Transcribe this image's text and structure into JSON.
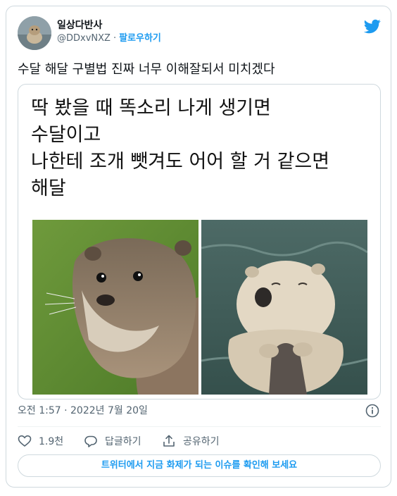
{
  "user": {
    "display_name": "일상다반사",
    "handle": "@DDxvNXZ",
    "separator": "·",
    "follow_label": "팔로우하기"
  },
  "tweet": {
    "text": "수달 해달 구별법 진짜 너무 이해잘되서 미치겠다"
  },
  "media": {
    "lines": [
      "딱 봤을 때 똑소리 나게 생기면",
      "수달이고",
      "나한테 조개 뺏겨도 어어 할 거 같으면",
      "해달"
    ]
  },
  "meta": {
    "timestamp": "오전 1:57 · 2022년 7월 20일"
  },
  "actions": {
    "like_count": "1.9천",
    "reply_label": "답글하기",
    "share_label": "공유하기"
  },
  "cta": {
    "label": "트위터에서 지금 화제가 되는 이슈를 확인해 보세요"
  },
  "colors": {
    "accent": "#1d9bf0",
    "secondary_text": "#536471",
    "border": "#cfd9de"
  }
}
